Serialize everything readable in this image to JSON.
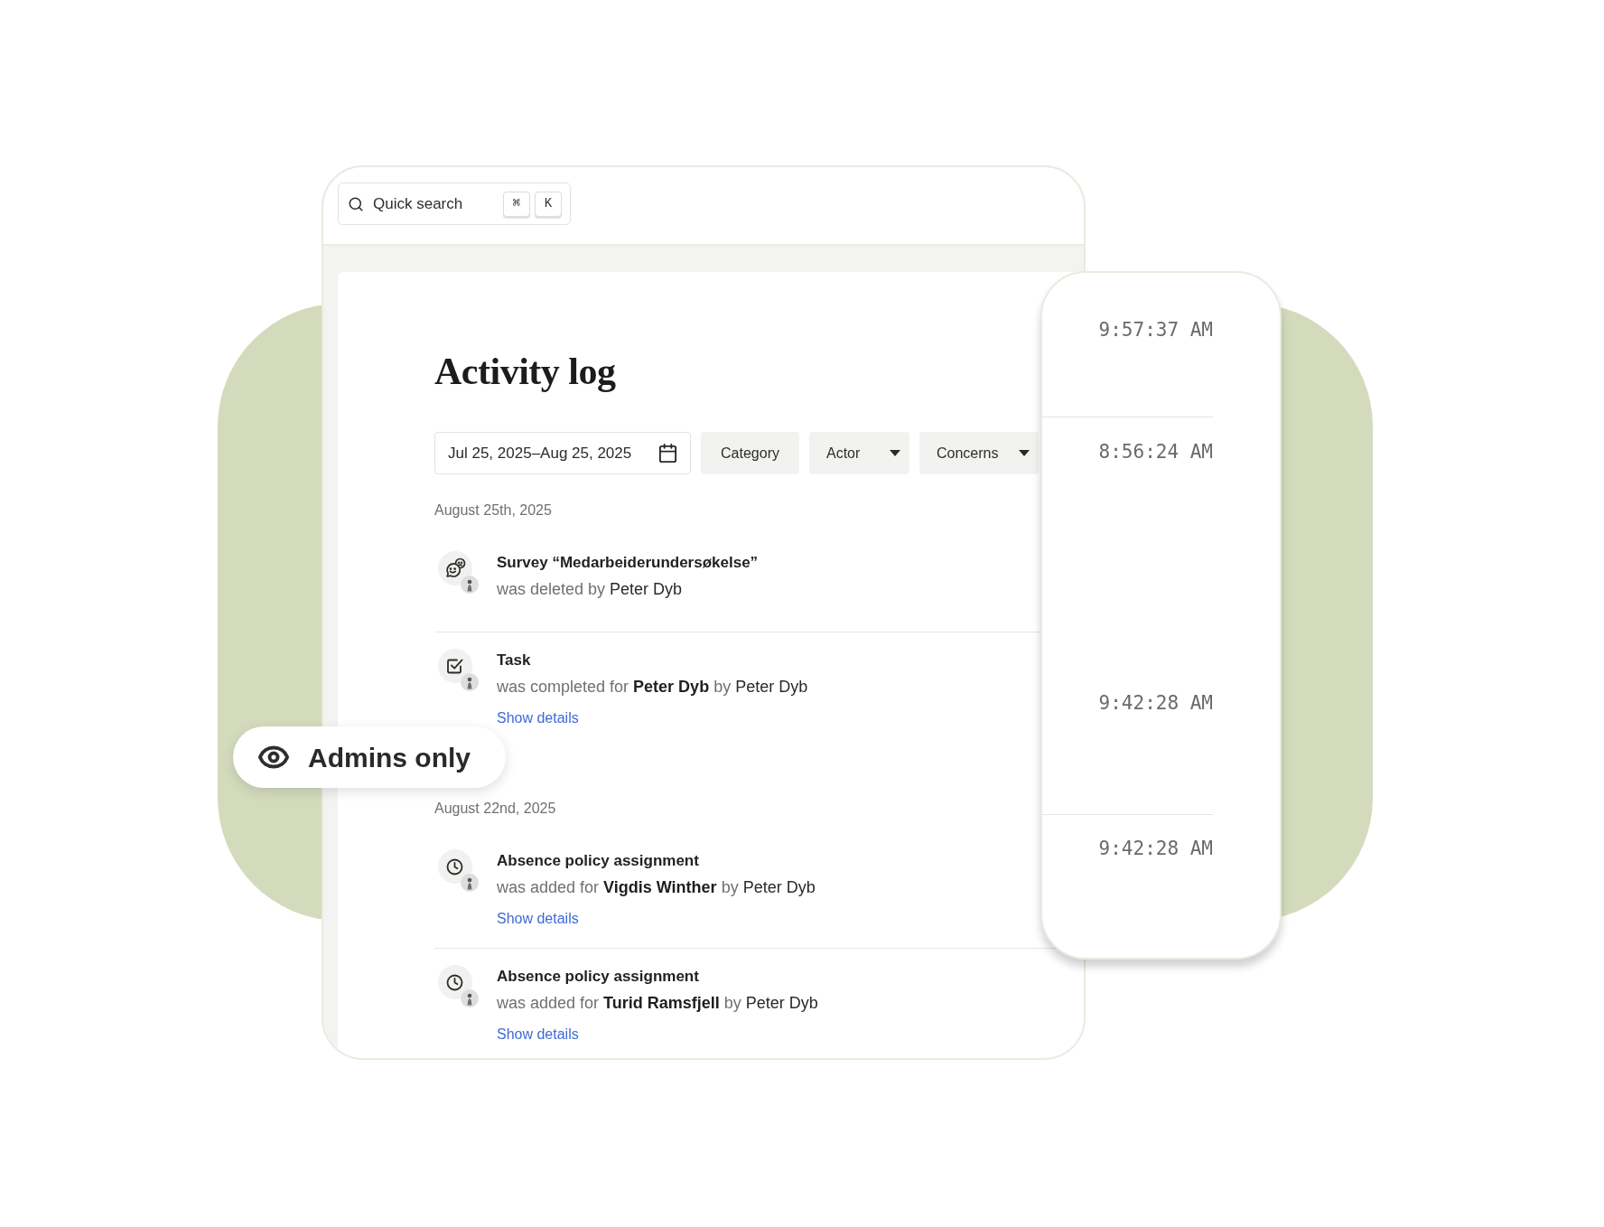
{
  "search": {
    "placeholder": "Quick search",
    "shortcut_keys": [
      "⌘",
      "K"
    ]
  },
  "page": {
    "title": "Activity log"
  },
  "filters": {
    "date_range": "Jul 25, 2025–Aug 25, 2025",
    "buttons": [
      {
        "label": "Category",
        "kind": "plain"
      },
      {
        "label": "Actor",
        "kind": "dropdown"
      },
      {
        "label": "Concerns",
        "kind": "dropdown"
      }
    ]
  },
  "groups": [
    {
      "date": "August 25th, 2025",
      "entries": [
        {
          "kind": "survey",
          "title": "Survey “Medarbeiderundersøkelse”",
          "description": [
            {
              "text": "was deleted by",
              "kind": "verb"
            },
            {
              "text": "Peter Dyb",
              "kind": "actor"
            }
          ]
        },
        {
          "kind": "task",
          "title": "Task",
          "description": [
            {
              "text": "was completed for",
              "kind": "verb"
            },
            {
              "text": "Peter Dyb",
              "kind": "subject"
            },
            {
              "text": "by",
              "kind": "verb"
            },
            {
              "text": "Peter Dyb",
              "kind": "actor"
            }
          ],
          "link": "Show details"
        }
      ]
    },
    {
      "date": "August 22nd, 2025",
      "entries": [
        {
          "kind": "absence_policy",
          "title": "Absence policy assignment",
          "description": [
            {
              "text": "was added for",
              "kind": "verb"
            },
            {
              "text": "Vigdis Winther",
              "kind": "subject"
            },
            {
              "text": "by",
              "kind": "verb"
            },
            {
              "text": "Peter Dyb",
              "kind": "actor"
            }
          ],
          "link": "Show details"
        },
        {
          "kind": "absence_policy",
          "title": "Absence policy assignment",
          "description": [
            {
              "text": "was added for",
              "kind": "verb"
            },
            {
              "text": "Turid Ramsfjell",
              "kind": "subject"
            },
            {
              "text": "by",
              "kind": "verb"
            },
            {
              "text": "Peter Dyb",
              "kind": "actor"
            }
          ],
          "link": "Show details"
        }
      ]
    }
  ],
  "badge": {
    "label": "Admins only"
  },
  "time_panel": {
    "groups": [
      [
        "9:57:37 AM"
      ],
      [
        "8:56:24 AM",
        "9:42:28 AM"
      ],
      [
        "9:42:28 AM"
      ]
    ]
  }
}
